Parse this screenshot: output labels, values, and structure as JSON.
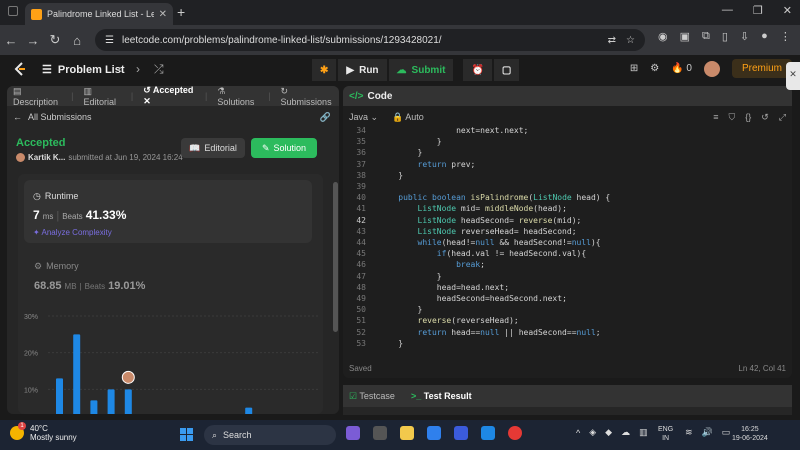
{
  "browser": {
    "tab_title": "Palindrome Linked List - LeetCo",
    "url": "leetcode.com/problems/palindrome-linked-list/submissions/1293428021/"
  },
  "header": {
    "problem_list": "Problem List",
    "run": "Run",
    "submit": "Submit",
    "streak": "0",
    "premium": "Premium"
  },
  "left_tabs": [
    "Description",
    "Editorial",
    "Accepted",
    "Solutions",
    "Submissions"
  ],
  "submission": {
    "back_label": "All Submissions",
    "status": "Accepted",
    "user": "Kartik K...",
    "submitted_at": "submitted at Jun 19, 2024 16:24",
    "editorial_button": "Editorial",
    "solution_button": "Solution",
    "runtime_title": "Runtime",
    "runtime_value": "7",
    "runtime_unit": "ms",
    "runtime_beats_label": "Beats",
    "runtime_beats": "41.33%",
    "analyze": "Analyze Complexity",
    "memory_title": "Memory",
    "memory_value": "68.85",
    "memory_unit": "MB",
    "memory_beats_label": "Beats",
    "memory_beats": "19.01%"
  },
  "chart_data": {
    "type": "bar",
    "y_ticks": [
      "30%",
      "20%",
      "10%"
    ],
    "ylim": [
      0,
      30
    ],
    "values": [
      13,
      25,
      7,
      10,
      10,
      0,
      1,
      0,
      0,
      0,
      0,
      5
    ]
  },
  "editor": {
    "title": "Code",
    "language": "Java",
    "mode": "Auto",
    "saved": "Saved",
    "cursor": "Ln 42, Col 41",
    "lines": [
      {
        "n": "34",
        "t": "                next=next.next;"
      },
      {
        "n": "35",
        "t": "            }"
      },
      {
        "n": "36",
        "t": "        }"
      },
      {
        "n": "37",
        "t": "        return prev;"
      },
      {
        "n": "38",
        "t": "    }"
      },
      {
        "n": "39",
        "t": ""
      },
      {
        "n": "40",
        "t": "    public boolean isPalindrome(ListNode head) {"
      },
      {
        "n": "41",
        "t": "        ListNode mid= middleNode(head);"
      },
      {
        "n": "42",
        "t": "        ListNode headSecond= reverse(mid);"
      },
      {
        "n": "43",
        "t": "        ListNode reverseHead= headSecond;"
      },
      {
        "n": "44",
        "t": "        while(head!=null && headSecond!=null){"
      },
      {
        "n": "45",
        "t": "            if(head.val != headSecond.val){"
      },
      {
        "n": "46",
        "t": "                break;"
      },
      {
        "n": "47",
        "t": "            }"
      },
      {
        "n": "48",
        "t": "            head=head.next;"
      },
      {
        "n": "49",
        "t": "            headSecond=headSecond.next;"
      },
      {
        "n": "50",
        "t": "        }"
      },
      {
        "n": "51",
        "t": "        reverse(reverseHead);"
      },
      {
        "n": "52",
        "t": "        return head==null || headSecond==null;"
      },
      {
        "n": "53",
        "t": "    }"
      }
    ]
  },
  "bottom_tabs": [
    "Testcase",
    "Test Result"
  ],
  "taskbar": {
    "temp": "40°C",
    "weather": "Mostly sunny",
    "search": "Search",
    "lang1": "ENG",
    "lang2": "IN",
    "time": "16:25",
    "date": "19-06-2024"
  }
}
